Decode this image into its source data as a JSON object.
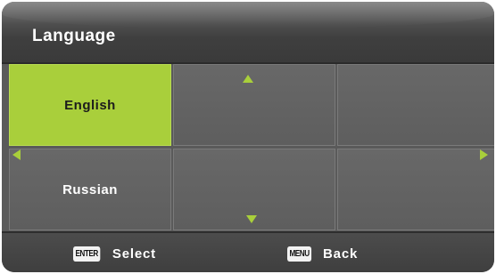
{
  "title": "Language",
  "languages": {
    "items": [
      "English",
      "Russian"
    ],
    "selected": "English"
  },
  "footer": {
    "select_key": "ENTER",
    "select_label": "Select",
    "back_key": "MENU",
    "back_label": "Back"
  },
  "colors": {
    "accent": "#a9cf3b",
    "panel": "#5e5e5e",
    "header": "#3f3f3f"
  }
}
